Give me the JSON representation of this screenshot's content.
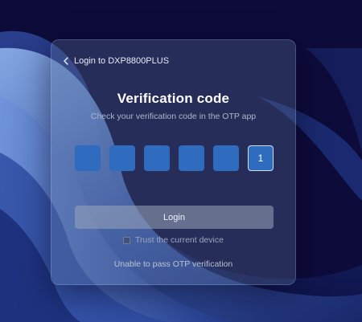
{
  "dialog": {
    "back_label": "Login to DXP8800PLUS",
    "title": "Verification code",
    "subtitle": "Check your verification code in the OTP app",
    "otp_digits": [
      "",
      "",
      "",
      "",
      "",
      "1"
    ],
    "login_label": "Login",
    "trust_label": "Trust the current device",
    "trust_checked": false,
    "unable_label": "Unable to pass OTP verification"
  },
  "colors": {
    "background": "#0d0b3a",
    "otp_box": "#2f6cc0",
    "accent_active": "#cfe0ff"
  },
  "icons": {
    "back": "chevron-left-icon"
  }
}
